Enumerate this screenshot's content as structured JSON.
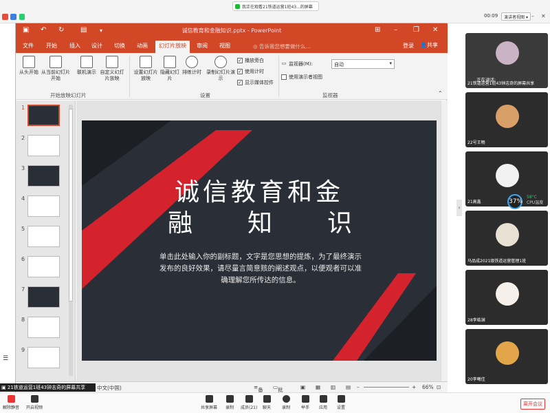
{
  "meeting": {
    "share_banner": "我正在观看21铁道运营1班43...的屏幕",
    "timer": "00:09",
    "presenter_view": "演讲者视图",
    "presenter_view_arrow": "▾",
    "speaking_label": "正在讲话:",
    "sharer_label": "21铁道运营1班43钟志奇的屏幕共享",
    "colors": {
      "share_dot": "#1bb934",
      "leave": "#ee3333"
    }
  },
  "ppt": {
    "doc_title": "诚信教育和金融知识.pptx - PowerPoint",
    "tabs": [
      "文件",
      "开始",
      "插入",
      "设计",
      "切换",
      "动画",
      "幻灯片放映",
      "审阅",
      "视图"
    ],
    "active_tab": "幻灯片放映",
    "tell_me": "告诉我您想要做什么...",
    "login": "登录",
    "share": "共享",
    "ribbon": {
      "from_start": "从头开始",
      "from_current": "从当前幻灯片开始",
      "online": "联机演示",
      "custom": "自定义幻灯片放映",
      "group_start": "开始放映幻灯片",
      "setup": "设置幻灯片放映",
      "hide": "隐藏幻灯片",
      "rehearse": "排练计时",
      "record": "录制幻灯片演示",
      "chk_narration": "播放旁白",
      "chk_timing": "使用计时",
      "chk_media": "显示媒体控件",
      "group_setup": "设置",
      "monitor_label": "监视器(M):",
      "monitor_value": "自动",
      "presenter_view": "使用演示者视图",
      "group_monitor": "监视器"
    },
    "slide_numbers": [
      "1",
      "2",
      "3",
      "4",
      "5",
      "6",
      "7",
      "8",
      "9"
    ],
    "slide": {
      "title_line1": "诚信教育和金",
      "title_line2": [
        "融",
        "知",
        "识"
      ],
      "subtitle": "单击此处输入你的副标题，文字是您思想的提炼，为了最终演示发布的良好效果，请尽量言简意赅的阐述观点，以便观者可以准确理解您所传达的信息。",
      "colors": {
        "background": "#2a2e36",
        "accent": "#d4232c"
      }
    },
    "status": {
      "language": "中文(中国)",
      "notes": "备注",
      "comments": "批注",
      "zoom": "66%"
    }
  },
  "participants": [
    {
      "name": "21铁道运营1班43钟志奇的屏幕共享",
      "avatar_color": "#c9b3c4"
    },
    {
      "name": "22号王畅",
      "avatar_color": "#d8a066"
    },
    {
      "name": "21高鑫",
      "avatar_color": "#f2f2f2"
    },
    {
      "name": "马品成2021级铁道运营管理1班",
      "avatar_color": "#e8e0d2"
    },
    {
      "name": "28李皓渊",
      "avatar_color": "#f5f0ea"
    },
    {
      "name": "20李曦佳",
      "avatar_color": "#e2a54a"
    }
  ],
  "cpu": {
    "percent": "37%",
    "temp": "58°C",
    "label": "CPU温度"
  },
  "bottom_bar": {
    "mute": "解除静音",
    "video": "开启视频",
    "share_screen": "共享屏幕",
    "record": "录制",
    "members": "成员(21)",
    "chat": "聊天",
    "rec2": "录制",
    "raise": "举手",
    "apps": "应用",
    "settings": "设置",
    "leave": "离开会议"
  }
}
